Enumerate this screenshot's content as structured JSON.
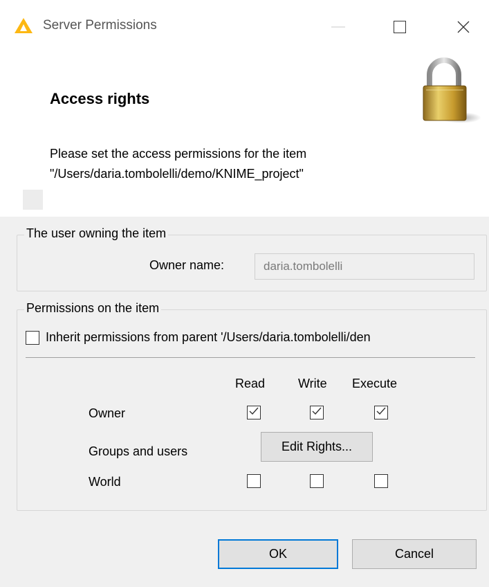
{
  "window": {
    "title": "Server Permissions",
    "icon": "knime-triangle-icon",
    "controls": [
      "minimize-icon",
      "maximize-icon",
      "close-icon"
    ]
  },
  "header": {
    "heading": "Access rights",
    "message_line1": "Please set the access permissions for the item",
    "message_line2": "\"/Users/daria.tombolelli/demo/KNIME_project\"",
    "image": "padlock-icon"
  },
  "owner_group": {
    "legend": "The user owning the item",
    "owner_label": "Owner name:",
    "owner_value": "daria.tombolelli"
  },
  "permissions_group": {
    "legend": "Permissions on the item",
    "inherit_label": "Inherit permissions from parent '/Users/daria.tombolelli/den",
    "inherit_checked": false,
    "columns": [
      "Read",
      "Write",
      "Execute"
    ],
    "rows": {
      "owner": {
        "label": "Owner",
        "read": true,
        "write": true,
        "execute": true
      },
      "groups": {
        "label": "Groups and users",
        "button": "Edit Rights..."
      },
      "world": {
        "label": "World",
        "read": false,
        "write": false,
        "execute": false
      }
    }
  },
  "footer": {
    "ok": "OK",
    "cancel": "Cancel"
  },
  "colors": {
    "accent": "#0078d7",
    "knime_yellow": "#fdb813"
  }
}
